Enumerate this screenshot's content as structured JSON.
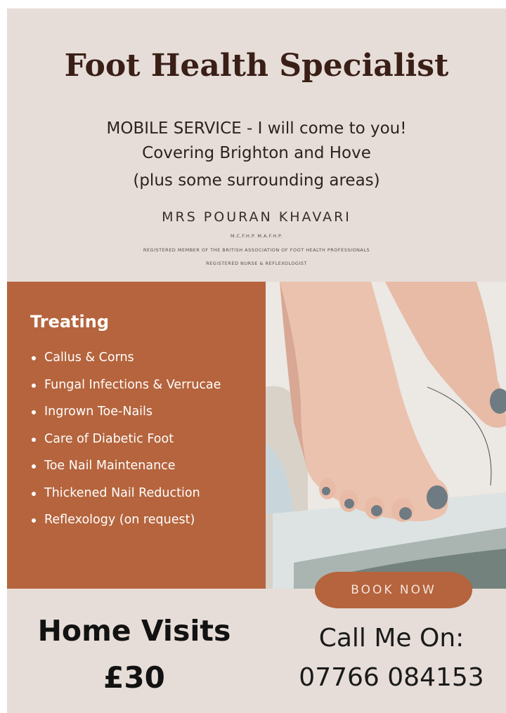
{
  "poster": {
    "title": "Foot Health Specialist",
    "intro_lines": [
      "MOBILE SERVICE - I will come to you!",
      "Covering Brighton and Hove",
      "(plus some surrounding areas)"
    ],
    "practitioner_name": "MRS POURAN KHAVARI",
    "credentials": "M.C.F.H.P.   M.A.F.H.P.",
    "membership_line": "REGISTERED MEMBER OF THE BRITISH ASSOCIATION OF FOOT HEALTH PROFESSIONALS",
    "registration_line": "REGISTERED NURSE & REFLEXOLOGIST",
    "treating_heading": "Treating",
    "treatments": [
      "Callus & Corns",
      "Fungal Infections & Verrucae",
      "Ingrown Toe-Nails",
      "Care of Diabetic Foot",
      "Toe Nail Maintenance",
      "Thickened Nail Reduction",
      "Reflexology (on request)"
    ],
    "book_button": "BOOK NOW",
    "home_visits_label": "Home Visits",
    "price": "£30",
    "call_label": "Call Me On:",
    "phone": "07766 084153"
  },
  "colors": {
    "background": "#e6ddd8",
    "accent": "#b5643d",
    "title": "#3a1f17",
    "nail_polish": "#6f7b83"
  },
  "photo": {
    "subject": "bare feet with grey painted toenails"
  }
}
